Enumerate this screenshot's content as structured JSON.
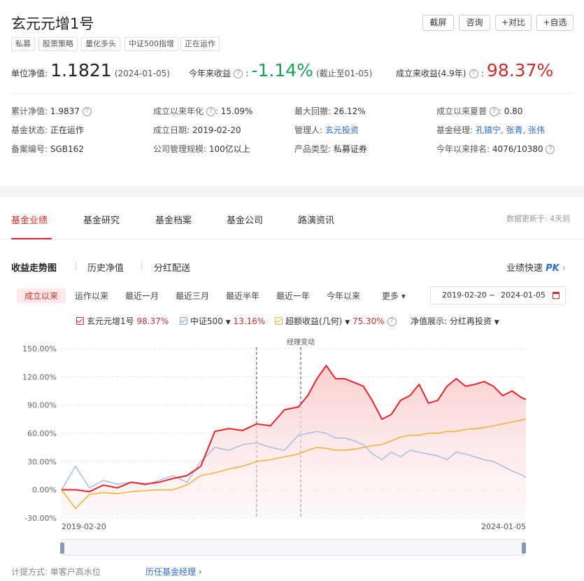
{
  "fund": {
    "name": "玄元元增1号",
    "tags": [
      "私募",
      "股票策略",
      "量化多头",
      "中证500指增",
      "正在运作"
    ]
  },
  "actions": {
    "screenshot": "截屏",
    "consult": "咨询",
    "compare": "+对比",
    "watchlist": "+自选"
  },
  "metrics": {
    "nav_label": "单位净值:",
    "nav_value": "1.1821",
    "nav_date": "(2024-01-05)",
    "ytd_label": "今年来收益",
    "ytd_value": "-1.14%",
    "ytd_note": "(截止至01-05)",
    "since_label": "成立来收益(4.9年)",
    "since_value": "98.37%"
  },
  "info": {
    "cum_nav_label": "累计净值:",
    "cum_nav_value": "1.9837",
    "annual_label": "成立以来年化",
    "annual_value": "15.09%",
    "drawdown_label": "最大回撤:",
    "drawdown_value": "26.12%",
    "sharpe_label": "成立以来夏普",
    "sharpe_value": "0.80",
    "status_label": "基金状态:",
    "status_value": "正在运作",
    "inception_label": "成立日期:",
    "inception_value": "2019-02-20",
    "manager_label": "管理人:",
    "manager_value": "玄元投资",
    "pm_label": "基金经理:",
    "pm_value": "孔镇宁, 张青, 张伟",
    "reg_label": "备案编号:",
    "reg_value": "SGB162",
    "scale_label": "公司管理规模:",
    "scale_value": "100亿以上",
    "type_label": "产品类型:",
    "type_value": "私募证券",
    "rank_label": "今年以来排名:",
    "rank_value": "4076/10380"
  },
  "tabs": [
    "基金业绩",
    "基金研究",
    "基金档案",
    "基金公司",
    "路演资讯"
  ],
  "update_note": "数据更新于: 4天前",
  "subtabs": [
    "收益走势图",
    "历史净值",
    "分红配送"
  ],
  "pk": {
    "label": "业绩快速",
    "pk": "PK"
  },
  "ranges": [
    "成立以来",
    "运作以来",
    "最近一月",
    "最近三月",
    "最近半年",
    "最近一年",
    "今年以来",
    "更多"
  ],
  "date_range": {
    "start": "2019-02-20",
    "tilde": "~",
    "end": "2024-01-05"
  },
  "legend": {
    "fund_name": "玄元元增1号",
    "fund_value": "98.37%",
    "index_name": "中证500",
    "index_value": "13.16%",
    "excess_name": "超额收益(几何)",
    "excess_value": "75.30%",
    "nav_display_label": "净值展示:",
    "nav_display_value": "分红再投资"
  },
  "footer": {
    "fee_label": "计提方式:",
    "fee_value": "单客户高水位",
    "history_link": "历任基金经理"
  },
  "colors": {
    "fund": "#e8232b",
    "index": "#a9bce6",
    "excess": "#f6b13c",
    "accent": "#d12d2d",
    "green": "#18a058"
  },
  "chart_data": {
    "type": "line",
    "yticks": [
      "150.00%",
      "120.00%",
      "90.00%",
      "60.00%",
      "30.00%",
      "0.00%",
      "-30.00%"
    ],
    "ylim": [
      -30,
      150
    ],
    "x_start": "2019-02-20",
    "x_end": "2024-01-05",
    "annotation": "经理变动",
    "series": [
      {
        "name": "玄元元增1号",
        "x": [
          0,
          0.03,
          0.06,
          0.09,
          0.12,
          0.15,
          0.18,
          0.21,
          0.24,
          0.27,
          0.3,
          0.33,
          0.36,
          0.39,
          0.42,
          0.45,
          0.48,
          0.51,
          0.53,
          0.55,
          0.57,
          0.59,
          0.61,
          0.63,
          0.65,
          0.67,
          0.69,
          0.71,
          0.73,
          0.75,
          0.77,
          0.79,
          0.81,
          0.83,
          0.85,
          0.87,
          0.89,
          0.91,
          0.93,
          0.95,
          0.97,
          0.99,
          1.0
        ],
        "values": [
          0,
          0,
          -2,
          5,
          2,
          8,
          6,
          8,
          12,
          15,
          25,
          62,
          65,
          63,
          70,
          68,
          85,
          88,
          100,
          118,
          132,
          118,
          118,
          114,
          110,
          94,
          75,
          80,
          95,
          100,
          112,
          92,
          95,
          110,
          118,
          110,
          112,
          115,
          110,
          100,
          105,
          98,
          96
        ]
      },
      {
        "name": "中证500",
        "x": [
          0,
          0.03,
          0.06,
          0.09,
          0.12,
          0.15,
          0.18,
          0.21,
          0.24,
          0.27,
          0.3,
          0.33,
          0.36,
          0.39,
          0.42,
          0.45,
          0.48,
          0.51,
          0.53,
          0.55,
          0.57,
          0.59,
          0.61,
          0.63,
          0.65,
          0.67,
          0.69,
          0.71,
          0.73,
          0.75,
          0.77,
          0.79,
          0.81,
          0.83,
          0.85,
          0.87,
          0.89,
          0.91,
          0.93,
          0.95,
          0.97,
          0.99,
          1.0
        ],
        "values": [
          0,
          25,
          2,
          10,
          6,
          8,
          5,
          10,
          15,
          8,
          30,
          45,
          42,
          48,
          50,
          45,
          42,
          58,
          60,
          62,
          60,
          55,
          55,
          52,
          48,
          38,
          32,
          40,
          35,
          42,
          40,
          38,
          36,
          32,
          40,
          38,
          35,
          32,
          30,
          25,
          20,
          16,
          13
        ]
      },
      {
        "name": "超额收益(几何)",
        "x": [
          0,
          0.03,
          0.06,
          0.09,
          0.12,
          0.15,
          0.18,
          0.21,
          0.24,
          0.27,
          0.3,
          0.33,
          0.36,
          0.39,
          0.42,
          0.45,
          0.48,
          0.51,
          0.53,
          0.55,
          0.57,
          0.59,
          0.61,
          0.63,
          0.65,
          0.67,
          0.69,
          0.71,
          0.73,
          0.75,
          0.77,
          0.79,
          0.81,
          0.83,
          0.85,
          0.87,
          0.89,
          0.91,
          0.93,
          0.95,
          0.97,
          0.99,
          1.0
        ],
        "values": [
          0,
          -20,
          -5,
          -3,
          -4,
          -2,
          -1,
          0,
          0,
          5,
          15,
          18,
          22,
          25,
          30,
          32,
          35,
          38,
          42,
          45,
          44,
          42,
          42,
          43,
          45,
          47,
          48,
          52,
          56,
          58,
          58,
          60,
          60,
          62,
          62,
          64,
          65,
          66,
          68,
          70,
          72,
          74,
          75
        ]
      }
    ]
  }
}
